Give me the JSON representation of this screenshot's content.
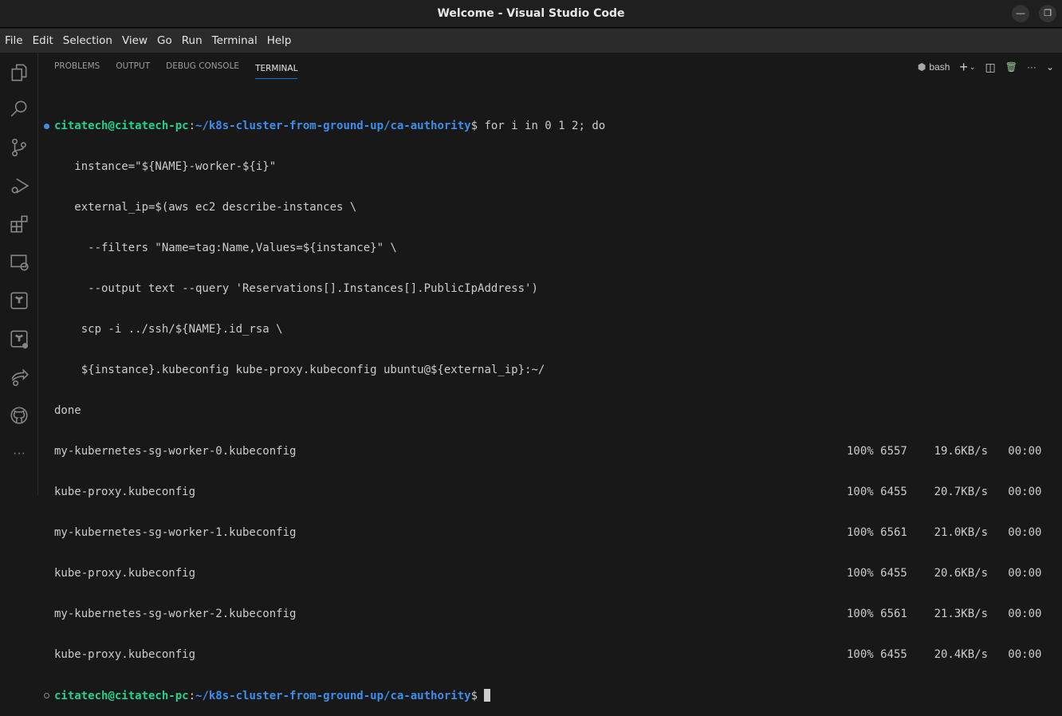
{
  "window": {
    "title": "Welcome - Visual Studio Code"
  },
  "menu": [
    "File",
    "Edit",
    "Selection",
    "View",
    "Go",
    "Run",
    "Terminal",
    "Help"
  ],
  "panel": {
    "tabs": [
      "PROBLEMS",
      "OUTPUT",
      "DEBUG CONSOLE",
      "TERMINAL"
    ],
    "active_tab": "TERMINAL",
    "shell": "bash"
  },
  "terminal": {
    "prompt_user": "citatech@citatech-pc",
    "prompt_path": "~/k8s-cluster-from-ground-up/ca-authority",
    "command": "for i in 0 1 2; do",
    "script_lines": [
      "   instance=\"${NAME}-worker-${i}\"",
      "   external_ip=$(aws ec2 describe-instances \\",
      "     --filters \"Name=tag:Name,Values=${instance}\" \\",
      "     --output text --query 'Reservations[].Instances[].PublicIpAddress')",
      "    scp -i ../ssh/${NAME}.id_rsa \\",
      "    ${instance}.kubeconfig kube-proxy.kubeconfig ubuntu@${external_ip}:~/",
      "done"
    ],
    "transfers": [
      {
        "file": "my-kubernetes-sg-worker-0.kubeconfig",
        "stats": "100% 6557    19.6KB/s   00:00"
      },
      {
        "file": "kube-proxy.kubeconfig",
        "stats": "100% 6455    20.7KB/s   00:00"
      },
      {
        "file": "my-kubernetes-sg-worker-1.kubeconfig",
        "stats": "100% 6561    21.0KB/s   00:00"
      },
      {
        "file": "kube-proxy.kubeconfig",
        "stats": "100% 6455    20.6KB/s   00:00"
      },
      {
        "file": "my-kubernetes-sg-worker-2.kubeconfig",
        "stats": "100% 6561    21.3KB/s   00:00"
      },
      {
        "file": "kube-proxy.kubeconfig",
        "stats": "100% 6455    20.4KB/s   00:00"
      }
    ]
  }
}
